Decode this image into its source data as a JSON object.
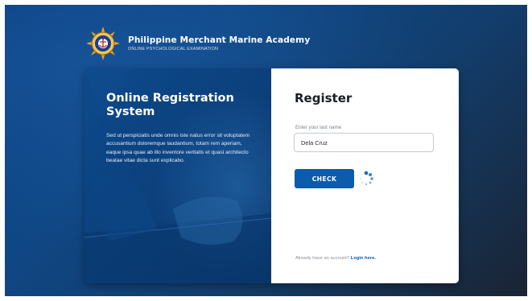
{
  "header": {
    "title": "Philippine Merchant Marine Academy",
    "subtitle": "ONLINE PSYCHOLOGICAL EXAMINATION",
    "logo_icon": "academy-seal-icon"
  },
  "hero": {
    "title": "Online Registration System",
    "description": "Sed ut perspiciatis unde omnis iste natus error sit voluptatem accusantium doloremque laudantium, totam rem aperiam, eaque ipsa quae ab illo inventore veritatis et quasi architecto beatae vitae dicta sunt explicabo."
  },
  "form": {
    "title": "Register",
    "lastname_label": "Enter your last name",
    "lastname_value": "Dela Cruz",
    "check_label": "CHECK",
    "loading_icon": "spinner-icon",
    "footer_prompt": "Already have an account?",
    "footer_link": "Login here."
  },
  "colors": {
    "primary_blue": "#0b5cad",
    "dark_navy": "#0c3f7a",
    "background_dark": "#1a2433"
  }
}
